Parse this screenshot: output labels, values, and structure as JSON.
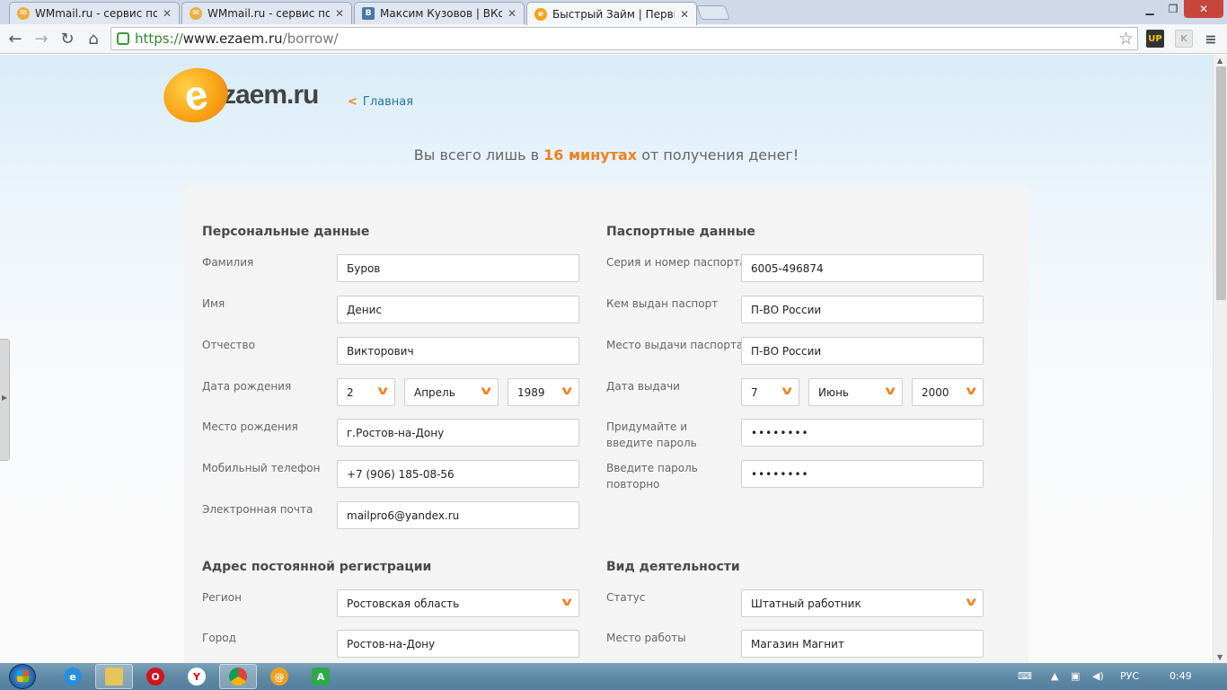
{
  "browser": {
    "tabs": [
      {
        "title": "WMmail.ru - сервис почт",
        "icon": "wmmail-icon",
        "color": "#e8b040"
      },
      {
        "title": "WMmail.ru - сервис почт",
        "icon": "wmmail-icon",
        "color": "#e8b040"
      },
      {
        "title": "Максим Кузовов | ВКонт",
        "icon": "vk-icon",
        "color": "#4a76a8"
      },
      {
        "title": "Быстрый Займ | Первый",
        "icon": "ezaem-icon",
        "color": "#f7a21b",
        "active": true
      }
    ],
    "url": {
      "scheme": "https://",
      "host": "www.ezaem.ru",
      "path": "/borrow/"
    }
  },
  "header": {
    "logo_letter": "e",
    "logo_text": "zaem.ru",
    "home_link": "Главная",
    "tagline_before": "Вы всего лишь в ",
    "tagline_highlight": "16 минутах",
    "tagline_after": " от получения денег!"
  },
  "personal": {
    "title": "Персональные данные",
    "last_name_label": "Фамилия",
    "last_name": "Буров",
    "first_name_label": "Имя",
    "first_name": "Денис",
    "patronymic_label": "Отчество",
    "patronymic": "Викторович",
    "birth_date_label": "Дата рождения",
    "birth_day": "2",
    "birth_month": "Апрель",
    "birth_year": "1989",
    "birth_place_label": "Место рождения",
    "birth_place": "г.Ростов-на-Дону",
    "phone_label": "Мобильный телефон",
    "phone": "+7 (906) 185-08-56",
    "email_label": "Электронная почта",
    "email": "mailpro6@yandex.ru"
  },
  "passport": {
    "title": "Паспортные данные",
    "number_label": "Серия и номер паспорта",
    "number": "6005-496874",
    "issued_by_label": "Кем выдан паспорт",
    "issued_by": "П-ВО России",
    "issue_place_label": "Место выдачи паспорта",
    "issue_place": "П-ВО России",
    "issue_date_label": "Дата выдачи",
    "issue_day": "7",
    "issue_month": "Июнь",
    "issue_year": "2000",
    "password_label": "Придумайте и введите пароль",
    "password": "••••••••",
    "password_repeat_label": "Введите пароль повторно",
    "password_repeat": "••••••••"
  },
  "address": {
    "title": "Адрес постоянной регистрации",
    "region_label": "Регион",
    "region": "Ростовская область",
    "city_label": "Город",
    "city": "Ростов-на-Дону"
  },
  "activity": {
    "title": "Вид деятельности",
    "status_label": "Статус",
    "status": "Штатный работник",
    "workplace_label": "Место работы",
    "workplace": "Магазин Магнит"
  },
  "taskbar": {
    "lang": "РУС",
    "time": "0:49"
  }
}
